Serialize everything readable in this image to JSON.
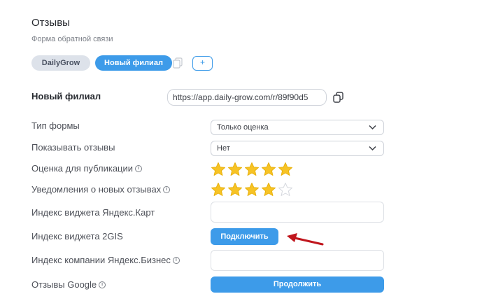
{
  "header": {
    "title": "Отзывы",
    "subtitle": "Форма обратной связи"
  },
  "tabs": [
    {
      "label": "DailyGrow",
      "active": false
    },
    {
      "label": "Новый филиал",
      "active": true
    }
  ],
  "add_button_label": "+",
  "branch": {
    "title": "Новый филиал",
    "url": "https://app.daily-grow.com/r/89f90d5"
  },
  "form": {
    "form_type": {
      "label": "Тип формы",
      "value": "Только оценка"
    },
    "show_reviews": {
      "label": "Показывать отзывы",
      "value": "Нет"
    },
    "publish_rating": {
      "label": "Оценка для публикации",
      "stars_filled": 5,
      "stars_total": 5
    },
    "notifications": {
      "label": "Уведомления о новых отзывах",
      "stars_filled": 4,
      "stars_total": 5
    },
    "yandex_maps_widget": {
      "label": "Индекс виджета Яндекс.Карт",
      "value": ""
    },
    "gis_widget": {
      "label": "Индекс виджета 2GIS",
      "button_label": "Подключить"
    },
    "yandex_business": {
      "label": "Индекс компании Яндекс.Бизнес",
      "value": ""
    },
    "google_reviews": {
      "label": "Отзывы Google",
      "button_label": "Продолжить"
    }
  },
  "colors": {
    "accent": "#3d9be9",
    "star_filled": "#f7c325",
    "arrow": "#c0161d"
  }
}
